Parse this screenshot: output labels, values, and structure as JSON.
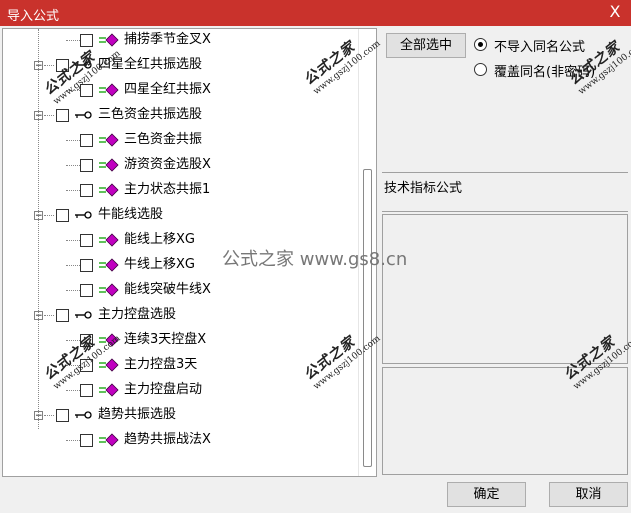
{
  "window": {
    "title": "导入公式",
    "close_glyph": "X"
  },
  "tree": [
    {
      "type": "leaf",
      "label": "捕捞季节金叉X"
    },
    {
      "type": "group",
      "label": "四星全红共振选股"
    },
    {
      "type": "leaf",
      "label": "四星全红共振X"
    },
    {
      "type": "group",
      "label": "三色资金共振选股"
    },
    {
      "type": "leaf",
      "label": "三色资金共振"
    },
    {
      "type": "leaf",
      "label": "游资资金选股X"
    },
    {
      "type": "leaf",
      "label": "主力状态共振1"
    },
    {
      "type": "group",
      "label": "牛能线选股"
    },
    {
      "type": "leaf",
      "label": "能线上移XG"
    },
    {
      "type": "leaf",
      "label": "牛线上移XG"
    },
    {
      "type": "leaf",
      "label": "能线突破牛线X"
    },
    {
      "type": "group",
      "label": "主力控盘选股"
    },
    {
      "type": "leaf",
      "label": "连续3天控盘X"
    },
    {
      "type": "leaf",
      "label": "主力控盘3天"
    },
    {
      "type": "leaf",
      "label": "主力控盘启动"
    },
    {
      "type": "group",
      "label": "趋势共振选股"
    },
    {
      "type": "leaf",
      "label": "趋势共振战法X"
    }
  ],
  "controls": {
    "select_all_label": "全部选中",
    "radio_skip_label": "不导入同名公式",
    "radio_overwrite_label": "覆盖同名(非密码)",
    "radio_selected": "skip",
    "category_label": "技术指标公式"
  },
  "buttons": {
    "ok_label": "确定",
    "cancel_label": "取消"
  },
  "watermark": {
    "brand": "公式之家",
    "domain": "www.gszj100.com",
    "center": "公式之家 www.gs8.cn"
  },
  "colors": {
    "titlebar": "#c9322c",
    "fx_diamond": "#c000c0",
    "fx_mark": "#0aa000"
  }
}
